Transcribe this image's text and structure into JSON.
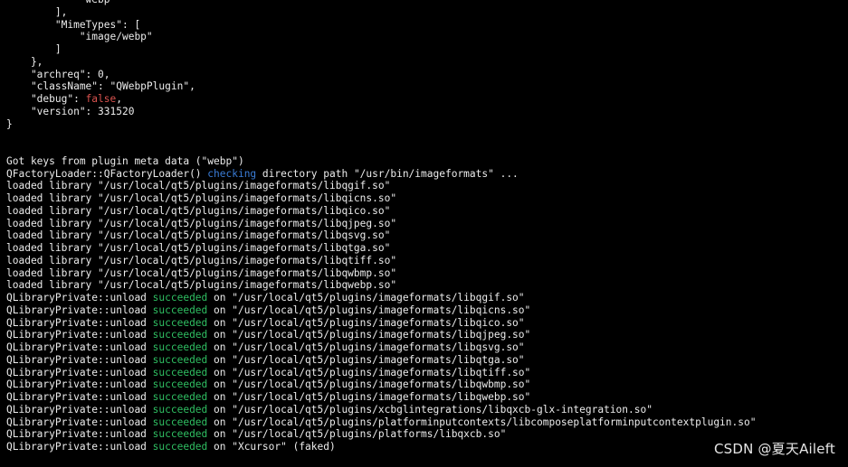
{
  "colors": {
    "background": "#000000",
    "text": "#ececec",
    "keyword": "#3a7cd6",
    "success": "#2fbf62",
    "bool": "#d9534f"
  },
  "lines": [
    [
      {
        "t": "            \"webp\""
      }
    ],
    [
      {
        "t": "        ],"
      }
    ],
    [
      {
        "t": "        \"MimeTypes\": ["
      }
    ],
    [
      {
        "t": "            \"image/webp\""
      }
    ],
    [
      {
        "t": "        ]"
      }
    ],
    [
      {
        "t": "    },"
      }
    ],
    [
      {
        "t": "    \"archreq\": 0,"
      }
    ],
    [
      {
        "t": "    \"className\": \"QWebpPlugin\","
      }
    ],
    [
      {
        "t": "    \"debug\": "
      },
      {
        "t": "false",
        "c": "bool"
      },
      {
        "t": ","
      }
    ],
    [
      {
        "t": "    \"version\": 331520"
      }
    ],
    [
      {
        "t": "}"
      }
    ],
    [
      {
        "t": ""
      }
    ],
    [
      {
        "t": ""
      }
    ],
    [
      {
        "t": "Got keys from plugin meta data (\"webp\")"
      }
    ],
    [
      {
        "t": "QFactoryLoader::QFactoryLoader() "
      },
      {
        "t": "checking",
        "c": "keyword"
      },
      {
        "t": " directory path \"/usr/bin/imageformats\" ..."
      }
    ],
    [
      {
        "t": "loaded library \"/usr/local/qt5/plugins/imageformats/libqgif.so\""
      }
    ],
    [
      {
        "t": "loaded library \"/usr/local/qt5/plugins/imageformats/libqicns.so\""
      }
    ],
    [
      {
        "t": "loaded library \"/usr/local/qt5/plugins/imageformats/libqico.so\""
      }
    ],
    [
      {
        "t": "loaded library \"/usr/local/qt5/plugins/imageformats/libqjpeg.so\""
      }
    ],
    [
      {
        "t": "loaded library \"/usr/local/qt5/plugins/imageformats/libqsvg.so\""
      }
    ],
    [
      {
        "t": "loaded library \"/usr/local/qt5/plugins/imageformats/libqtga.so\""
      }
    ],
    [
      {
        "t": "loaded library \"/usr/local/qt5/plugins/imageformats/libqtiff.so\""
      }
    ],
    [
      {
        "t": "loaded library \"/usr/local/qt5/plugins/imageformats/libqwbmp.so\""
      }
    ],
    [
      {
        "t": "loaded library \"/usr/local/qt5/plugins/imageformats/libqwebp.so\""
      }
    ],
    [
      {
        "t": "QLibraryPrivate::unload "
      },
      {
        "t": "succeeded",
        "c": "success"
      },
      {
        "t": " on \"/usr/local/qt5/plugins/imageformats/libqgif.so\""
      }
    ],
    [
      {
        "t": "QLibraryPrivate::unload "
      },
      {
        "t": "succeeded",
        "c": "success"
      },
      {
        "t": " on \"/usr/local/qt5/plugins/imageformats/libqicns.so\""
      }
    ],
    [
      {
        "t": "QLibraryPrivate::unload "
      },
      {
        "t": "succeeded",
        "c": "success"
      },
      {
        "t": " on \"/usr/local/qt5/plugins/imageformats/libqico.so\""
      }
    ],
    [
      {
        "t": "QLibraryPrivate::unload "
      },
      {
        "t": "succeeded",
        "c": "success"
      },
      {
        "t": " on \"/usr/local/qt5/plugins/imageformats/libqjpeg.so\""
      }
    ],
    [
      {
        "t": "QLibraryPrivate::unload "
      },
      {
        "t": "succeeded",
        "c": "success"
      },
      {
        "t": " on \"/usr/local/qt5/plugins/imageformats/libqsvg.so\""
      }
    ],
    [
      {
        "t": "QLibraryPrivate::unload "
      },
      {
        "t": "succeeded",
        "c": "success"
      },
      {
        "t": " on \"/usr/local/qt5/plugins/imageformats/libqtga.so\""
      }
    ],
    [
      {
        "t": "QLibraryPrivate::unload "
      },
      {
        "t": "succeeded",
        "c": "success"
      },
      {
        "t": " on \"/usr/local/qt5/plugins/imageformats/libqtiff.so\""
      }
    ],
    [
      {
        "t": "QLibraryPrivate::unload "
      },
      {
        "t": "succeeded",
        "c": "success"
      },
      {
        "t": " on \"/usr/local/qt5/plugins/imageformats/libqwbmp.so\""
      }
    ],
    [
      {
        "t": "QLibraryPrivate::unload "
      },
      {
        "t": "succeeded",
        "c": "success"
      },
      {
        "t": " on \"/usr/local/qt5/plugins/imageformats/libqwebp.so\""
      }
    ],
    [
      {
        "t": "QLibraryPrivate::unload "
      },
      {
        "t": "succeeded",
        "c": "success"
      },
      {
        "t": " on \"/usr/local/qt5/plugins/xcbglintegrations/libqxcb-glx-integration.so\""
      }
    ],
    [
      {
        "t": "QLibraryPrivate::unload "
      },
      {
        "t": "succeeded",
        "c": "success"
      },
      {
        "t": " on \"/usr/local/qt5/plugins/platforminputcontexts/libcomposeplatforminputcontextplugin.so\""
      }
    ],
    [
      {
        "t": "QLibraryPrivate::unload "
      },
      {
        "t": "succeeded",
        "c": "success"
      },
      {
        "t": " on \"/usr/local/qt5/plugins/platforms/libqxcb.so\""
      }
    ],
    [
      {
        "t": "QLibraryPrivate::unload "
      },
      {
        "t": "succeeded",
        "c": "success"
      },
      {
        "t": " on \"Xcursor\" (faked)"
      }
    ]
  ],
  "watermark": "CSDN @夏天Aileft"
}
